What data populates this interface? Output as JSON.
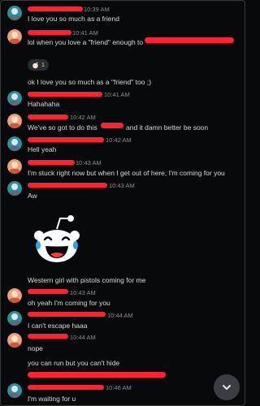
{
  "colors": {
    "background": "#08090b",
    "text": "#d7dadc",
    "timestamp": "#8b8f93",
    "redaction": "#ff2233",
    "reaction_bg": "#2a2c2f",
    "scroll_button": "#3a3d41"
  },
  "messages": [
    {
      "time": "10:39 AM",
      "text": "I love you so much as a friend"
    },
    {
      "time": "10:41 AM",
      "text": "lol when you love a \"friend\" enough to"
    },
    {
      "reaction_count": "1"
    },
    {
      "text": "ok I love you so much as a \"friend\" too ;)"
    },
    {
      "time": "10:41 AM",
      "text": "Hahahaha"
    },
    {
      "time": "10:42 AM",
      "text_a": "We've so got to do this",
      "text_b": "and it damn better be soon"
    },
    {
      "time": "10:42 AM",
      "text": "Hell yeah"
    },
    {
      "time": "10:43 AM",
      "text": "I'm stuck right now but when I get out of here, I'm coming for you"
    },
    {
      "time": "10:43 AM",
      "text": "Aw"
    },
    {
      "text": "Western girl with pistols coming for me"
    },
    {
      "time": "10:43 AM",
      "text": "oh yeah I'm coming for you"
    },
    {
      "time": "10:44 AM",
      "text": "I can't escape haaa"
    },
    {
      "time": "10:44 AM",
      "text": "nope"
    },
    {
      "text": "you can run but you can't hide"
    },
    {
      "time": "10:46 AM",
      "text": "I'm waiting for u"
    }
  ],
  "icons": {
    "reaction": "snoo-icon",
    "sticker": "laughing-snoo-sticker",
    "scroll": "chevron-down-icon"
  }
}
